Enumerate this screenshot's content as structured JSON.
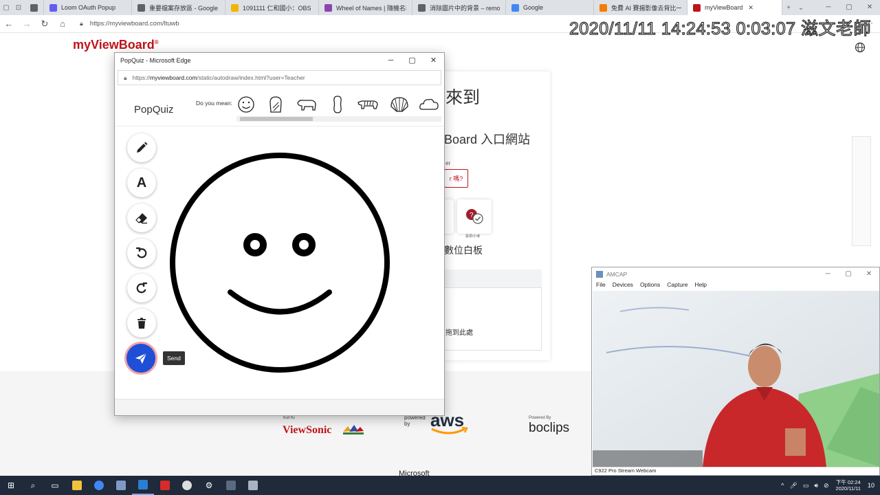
{
  "browser": {
    "tabs": [
      {
        "title": "",
        "color": "#5f6368"
      },
      {
        "title": "Loom OAuth Popup",
        "color": "#625df5"
      },
      {
        "title": "重要檔案存放區 - Google 書",
        "color": "#5f6368"
      },
      {
        "title": "1091111 仁和國小：OBS 畫",
        "color": "#f4b400"
      },
      {
        "title": "Wheel of Names | 隨機名稱",
        "color": "#8e44ad"
      },
      {
        "title": "消除圖片中的背景 – remove",
        "color": "#5f6368"
      },
      {
        "title": "Google",
        "color": "#4285f4"
      },
      {
        "title": "免費 AI 賽揚影像去背比一比",
        "color": "#f57c00"
      },
      {
        "title": "myViewBoard",
        "color": "#c0141b",
        "active": true
      }
    ],
    "new_tab": "+",
    "address": "https://myviewboard.com/ltuwb",
    "more": "···"
  },
  "overlay": {
    "timestamp": "2020/11/11 14:24:53 0:03:07 滋文老師"
  },
  "site": {
    "logo": "myViewBoard",
    "logo_mark": "®",
    "welcome": "來到",
    "portal": "Board 入口網站",
    "small": "er",
    "question_btn": "r 嗎?",
    "poll_label": "投票/小考",
    "whiteboard": "數位白板",
    "drop": "拖到此處",
    "built_by": "Built By",
    "viewsonic": "ViewSonic",
    "powered_by": "powered\nby",
    "aws": "aws",
    "powered_by_2": "Powered By",
    "boclips": "boclips",
    "microsoft": "Microsoft"
  },
  "popup": {
    "window_title": "PopQuiz - Microsoft Edge",
    "url_prefix": "https://",
    "url_host": "myviewboard.com",
    "url_path": "/static/autodraw/index.html?user=Teacher",
    "app_title": "PopQuiz",
    "suggest_label": "Do you mean:",
    "tools": [
      {
        "name": "pencil-icon"
      },
      {
        "name": "text-icon",
        "label": "A"
      },
      {
        "name": "eraser-icon"
      },
      {
        "name": "undo-icon"
      },
      {
        "name": "redo-icon"
      },
      {
        "name": "trash-icon"
      }
    ],
    "send_tooltip": "Send"
  },
  "amcap": {
    "title": "AMCAP",
    "menu": [
      "File",
      "Devices",
      "Options",
      "Capture",
      "Help"
    ],
    "status": "C922 Pro Stream Webcam"
  },
  "taskbar": {
    "clock_time": "下午 02:24",
    "clock_date": "2020/11/11",
    "notification_count": "10"
  }
}
